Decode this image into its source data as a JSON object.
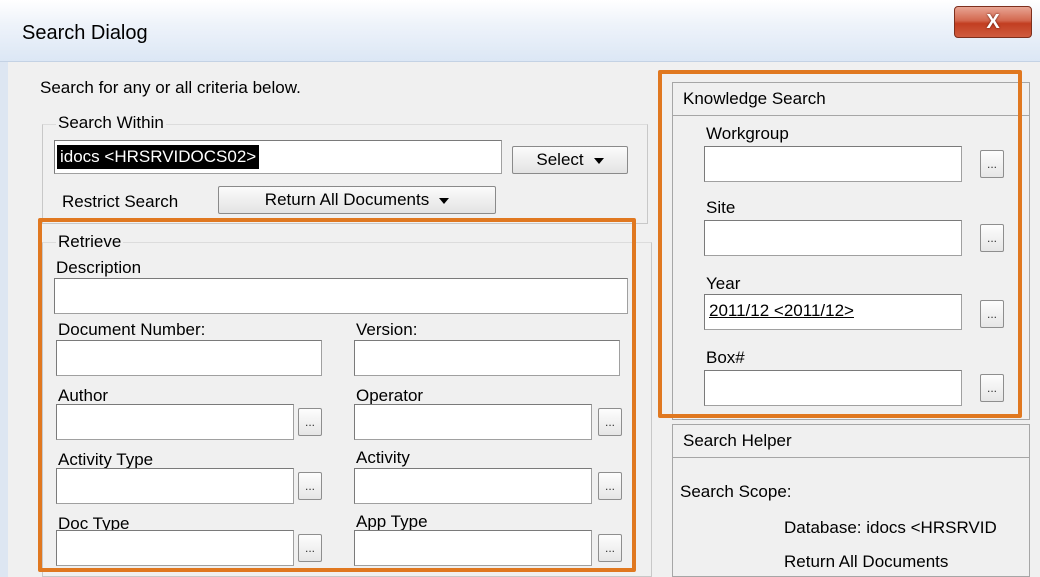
{
  "window": {
    "title": "Search Dialog",
    "close_label": "X"
  },
  "header": {
    "instruction": "Search for any or all   criteria below."
  },
  "search_within": {
    "legend": "Search Within",
    "value": "idocs <HRSRVIDOCS02>",
    "select_label": "Select",
    "restrict_label": "Restrict Search",
    "restrict_value": "Return All Documents"
  },
  "retrieve": {
    "legend": "Retrieve",
    "description_label": "Description",
    "document_number_label": "Document Number:",
    "version_label": "Version:",
    "author_label": "Author",
    "operator_label": "Operator",
    "activity_type_label": "Activity Type",
    "activity_label": "Activity",
    "doc_type_label": "Doc Type",
    "app_type_label": "App Type",
    "browse_label": "..."
  },
  "knowledge_search": {
    "title": "Knowledge Search",
    "workgroup_label": "Workgroup",
    "site_label": "Site",
    "year_label": "Year",
    "year_value": "2011/12 <2011/12>",
    "box_label": "Box#",
    "browse_label": "..."
  },
  "search_helper": {
    "title": "Search Helper",
    "scope_label": "Search Scope:",
    "database_line": "Database: idocs <HRSRVID",
    "restrict_line": "Return All Documents"
  },
  "colors": {
    "highlight": "#e07820",
    "selection": "#000000",
    "close_button": "#c94a2c"
  }
}
